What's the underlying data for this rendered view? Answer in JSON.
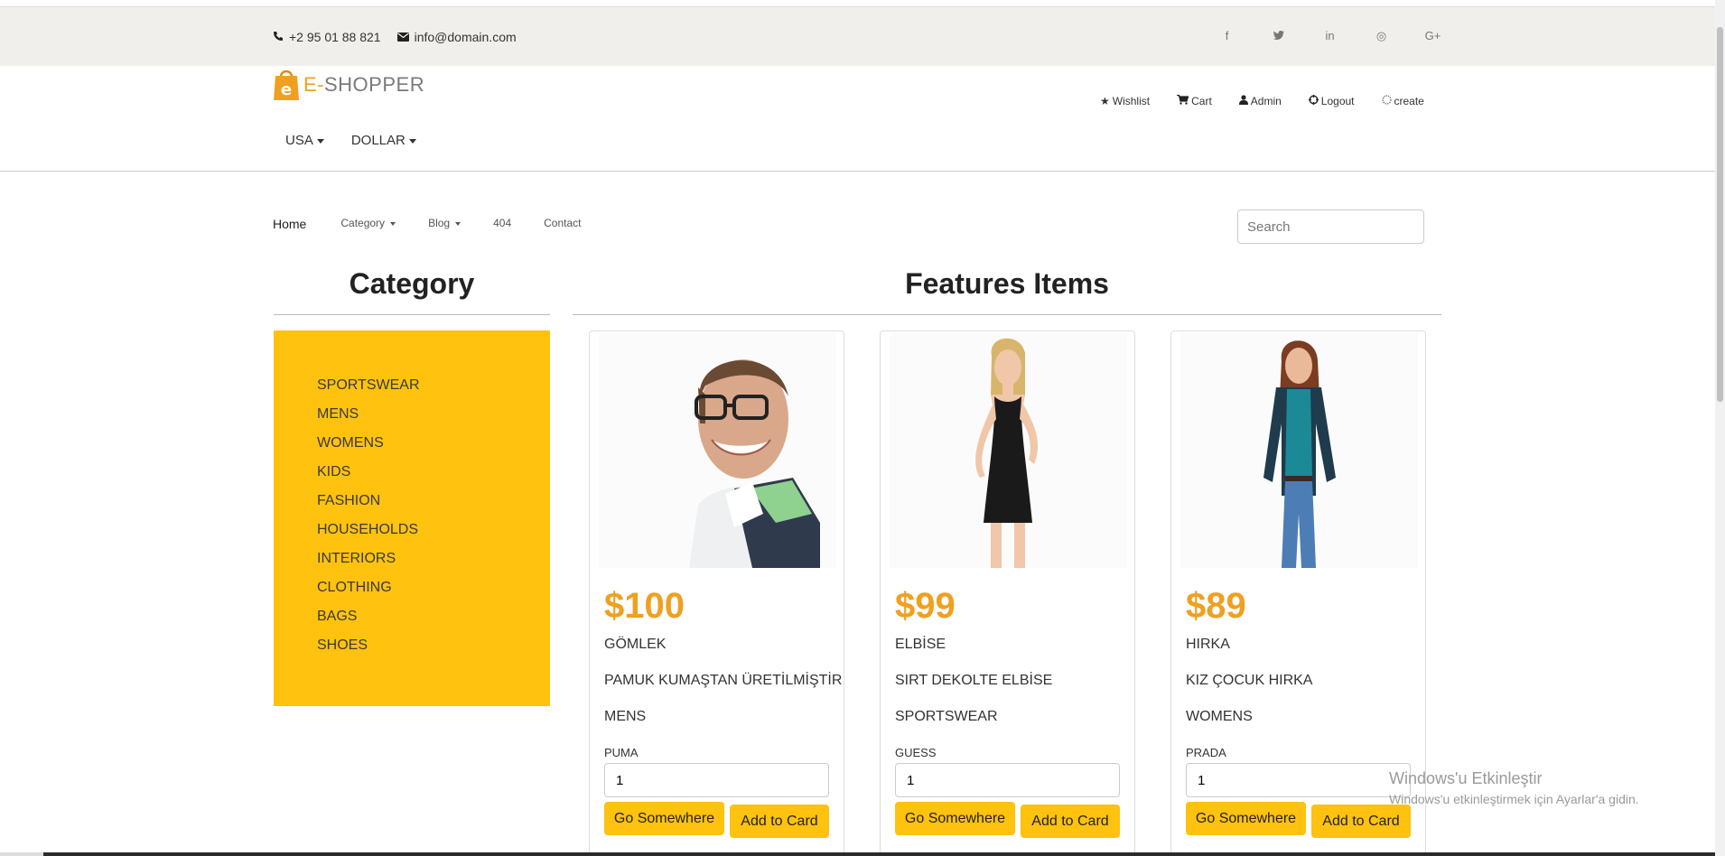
{
  "topbar": {
    "phone": "+2 95 01 88 821",
    "email": "info@domain.com",
    "social": [
      {
        "icon": "facebook-icon",
        "glyph": "f"
      },
      {
        "icon": "twitter-icon",
        "glyph": "🐦"
      },
      {
        "icon": "linkedin-icon",
        "glyph": "in"
      },
      {
        "icon": "dribbble-icon",
        "glyph": "◎"
      },
      {
        "icon": "google-plus-icon",
        "glyph": "G+"
      }
    ]
  },
  "header": {
    "logo_letter": "e",
    "logo_e": "E-",
    "logo_rest": "SHOPPER",
    "country": "USA",
    "currency": "DOLLAR",
    "menu": {
      "wishlist": "Wishlist",
      "cart": "Cart",
      "admin": "Admin",
      "logout": "Logout",
      "create": "create"
    }
  },
  "nav": {
    "home": "Home",
    "category": "Category",
    "blog": "Blog",
    "notfound": "404",
    "contact": "Contact",
    "search_placeholder": "Search"
  },
  "sidebar": {
    "title": "Category",
    "items": [
      "SPORTSWEAR",
      "MENS",
      "WOMENS",
      "KIDS",
      "FASHION",
      "HOUSEHOLDS",
      "INTERIORS",
      "CLOTHING",
      "BAGS",
      "SHOES"
    ]
  },
  "main": {
    "title": "Features Items",
    "products": [
      {
        "price": "$100",
        "name": "GÖMLEK",
        "description": "PAMUK KUMAŞTAN ÜRETİLMİŞTİR",
        "category": "MENS",
        "brand": "PUMA",
        "qty": "1",
        "go_label": "Go Somewhere",
        "add_label": "Add to Card"
      },
      {
        "price": "$99",
        "name": "ELBİSE",
        "description": "SIRT DEKOLTE ELBİSE",
        "category": "SPORTSWEAR",
        "brand": "GUESS",
        "qty": "1",
        "go_label": "Go Somewhere",
        "add_label": "Add to Card"
      },
      {
        "price": "$89",
        "name": "HIRKA",
        "description": "KIZ ÇOCUK HIRKA",
        "category": "WOMENS",
        "brand": "PRADA",
        "qty": "1",
        "go_label": "Go Somewhere",
        "add_label": "Add to Card"
      }
    ]
  },
  "watermark": {
    "line1": "Windows'u Etkinleştir",
    "line2": "Windows'u etkinleştirmek için Ayarlar'a gidin."
  },
  "colors": {
    "accent": "#fec20f",
    "price": "#f0a020",
    "topbar_bg": "#f0efeb"
  }
}
